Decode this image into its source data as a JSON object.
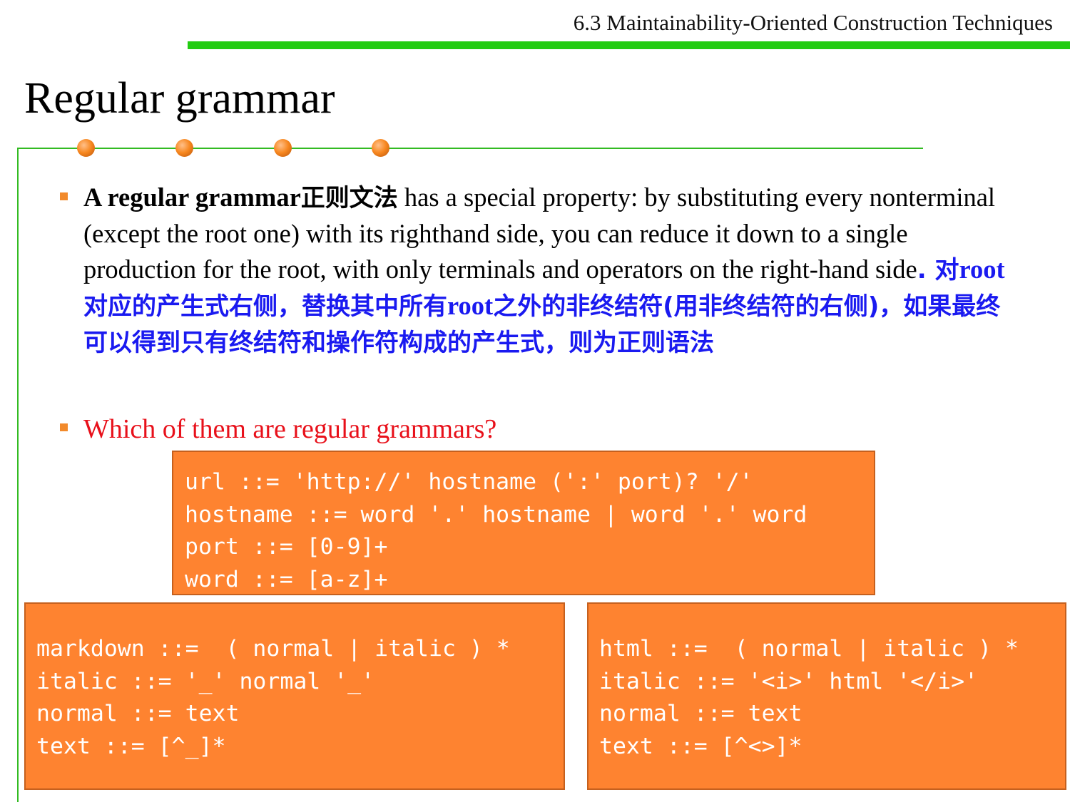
{
  "header": {
    "section_title": "6.3 Maintainability-Oriented Construction Techniques",
    "accent_color": "#22cc11"
  },
  "slide": {
    "title": "Regular grammar",
    "bullet_color": "#f28a2b"
  },
  "bullet1": {
    "bold_term": "A regular grammar",
    "term_cn": "正则文法",
    "body": " has a special property: by substituting every nonterminal (except the root one) with its righthand side, you can reduce it down to a single production for the root, with only terminals and operators on the right-hand side",
    "cn_parts": [
      ". 对",
      "root",
      "对应的产生式右侧，替换其中所有",
      "root",
      "之外的非终结符(用非终结符的右侧)，如果最终可以得到只有终结符和操作符构成的产生式，则为正则语法"
    ],
    "cn_color": "#1a1af0"
  },
  "bullet2": {
    "question": "Which of them are regular grammars?",
    "color": "#e8101a"
  },
  "grammars": {
    "url": [
      "url ::= 'http://' hostname (':' port)? '/'",
      "hostname ::= word '.' hostname | word '.' word",
      "port ::= [0-9]+",
      "word ::= [a-z]+"
    ],
    "markdown": [
      "markdown ::=  ( normal | italic ) *",
      "italic ::= '_' normal '_'",
      "normal ::= text",
      "text ::= [^_]*"
    ],
    "html": [
      "html ::=  ( normal | italic ) *",
      "italic ::= '<i>' html '</i>'",
      "normal ::= text",
      "text ::= [^<>]*"
    ],
    "box_color": "#fe8330"
  }
}
